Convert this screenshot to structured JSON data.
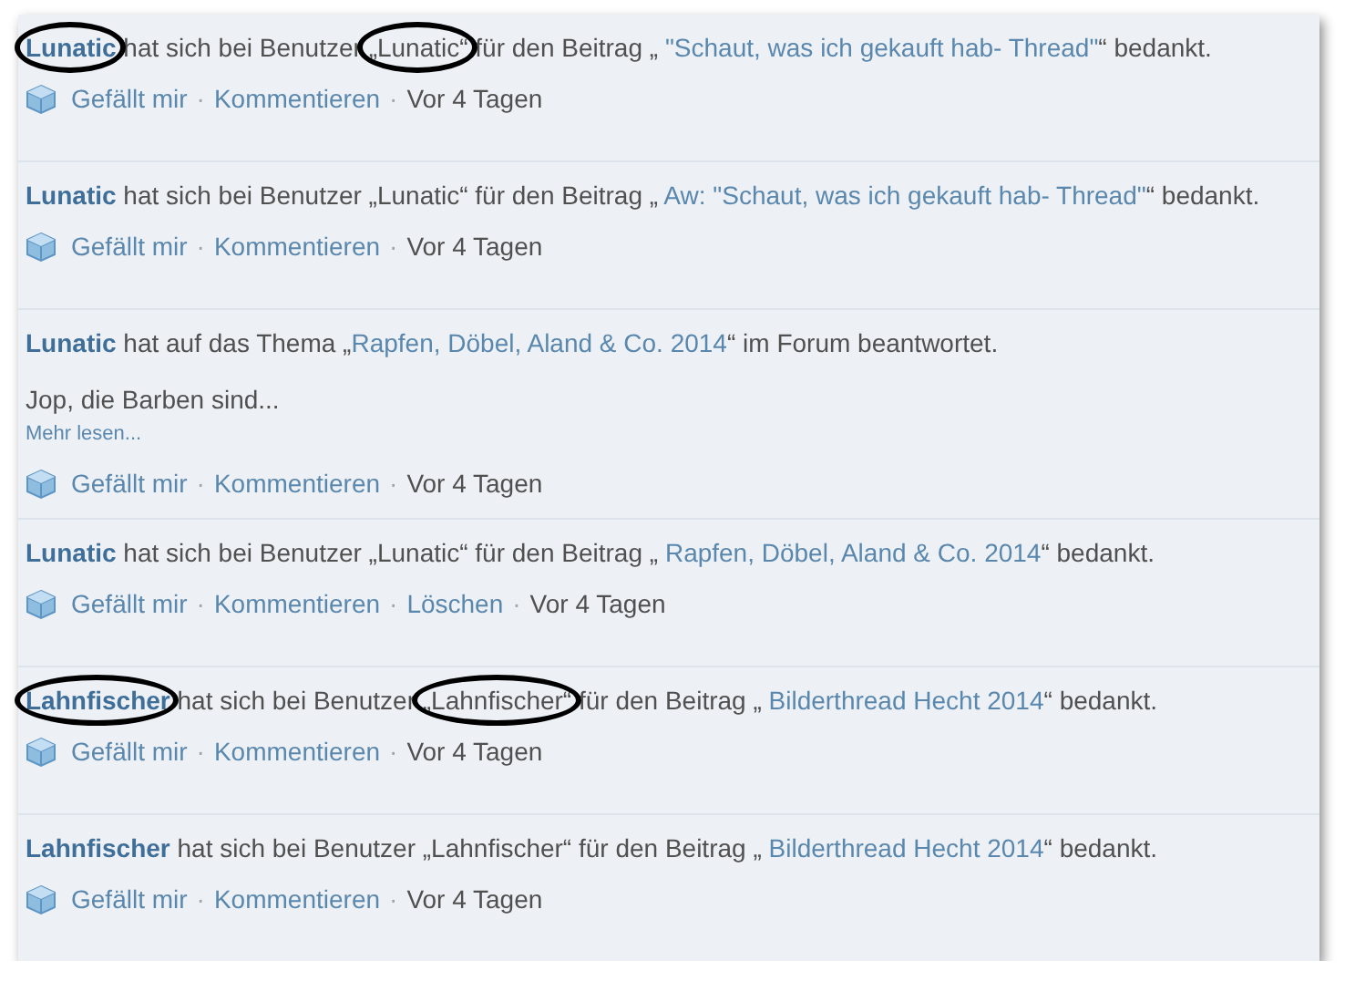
{
  "entries": [
    {
      "actor": "Lunatic",
      "actor_circled": true,
      "parts": [
        {
          "kind": "text",
          "text": " hat sich bei Benutzer ",
          "circled": false
        },
        {
          "kind": "text",
          "text": "„Lunatic“",
          "circled": true
        },
        {
          "kind": "text",
          "text": " für den Beitrag „ ",
          "circled": false
        },
        {
          "kind": "link",
          "text": "\"Schaut, was ich gekauft hab- Thread\"",
          "circled": false
        },
        {
          "kind": "text",
          "text": "“ bedankt.",
          "circled": false
        }
      ],
      "actions": [
        "Gefällt mir",
        "Kommentieren"
      ],
      "separator": "·",
      "time": "Vor 4 Tagen"
    },
    {
      "actor": "Lunatic",
      "actor_circled": false,
      "parts": [
        {
          "kind": "text",
          "text": " hat sich bei Benutzer „Lunatic“ für den Beitrag „ ",
          "circled": false
        },
        {
          "kind": "link",
          "text": "Aw: \"Schaut, was ich gekauft hab- Thread\"",
          "circled": false
        },
        {
          "kind": "text",
          "text": "“ bedankt.",
          "circled": false
        }
      ],
      "actions": [
        "Gefällt mir",
        "Kommentieren"
      ],
      "separator": "·",
      "time": "Vor 4 Tagen"
    },
    {
      "actor": "Lunatic",
      "actor_circled": false,
      "parts": [
        {
          "kind": "text",
          "text": " hat auf das Thema „",
          "circled": false
        },
        {
          "kind": "link",
          "text": "Rapfen, Döbel, Aland & Co. 2014",
          "circled": false
        },
        {
          "kind": "text",
          "text": "“ im Forum beantwortet.",
          "circled": false
        }
      ],
      "snippet": "Jop, die Barben sind...",
      "more": "Mehr lesen...",
      "actions": [
        "Gefällt mir",
        "Kommentieren"
      ],
      "separator": "·",
      "time": "Vor 4 Tagen"
    },
    {
      "actor": "Lunatic",
      "actor_circled": false,
      "parts": [
        {
          "kind": "text",
          "text": " hat sich bei Benutzer „Lunatic“ für den Beitrag „ ",
          "circled": false
        },
        {
          "kind": "link",
          "text": "Rapfen, Döbel, Aland & Co. 2014",
          "circled": false
        },
        {
          "kind": "text",
          "text": "“ bedankt.",
          "circled": false
        }
      ],
      "actions": [
        "Gefällt mir",
        "Kommentieren",
        "Löschen"
      ],
      "separator": "·",
      "time": "Vor 4 Tagen"
    },
    {
      "actor": "Lahnfischer",
      "actor_circled": true,
      "parts": [
        {
          "kind": "text",
          "text": " hat sich bei Benutzer ",
          "circled": false
        },
        {
          "kind": "text",
          "text": "„Lahnfischer“",
          "circled": true
        },
        {
          "kind": "text",
          "text": " für den Beitrag „ ",
          "circled": false
        },
        {
          "kind": "link",
          "text": "Bilderthread Hecht 2014",
          "circled": false
        },
        {
          "kind": "text",
          "text": "“ bedankt.",
          "circled": false
        }
      ],
      "actions": [
        "Gefällt mir",
        "Kommentieren"
      ],
      "separator": "·",
      "time": "Vor 4 Tagen"
    },
    {
      "actor": "Lahnfischer",
      "actor_circled": false,
      "parts": [
        {
          "kind": "text",
          "text": " hat sich bei Benutzer „Lahnfischer“ für den Beitrag „ ",
          "circled": false
        },
        {
          "kind": "link",
          "text": "Bilderthread Hecht 2014",
          "circled": false
        },
        {
          "kind": "text",
          "text": "“ bedankt.",
          "circled": false
        }
      ],
      "actions": [
        "Gefällt mir",
        "Kommentieren"
      ],
      "separator": "·",
      "time": "Vor 4 Tagen"
    }
  ]
}
